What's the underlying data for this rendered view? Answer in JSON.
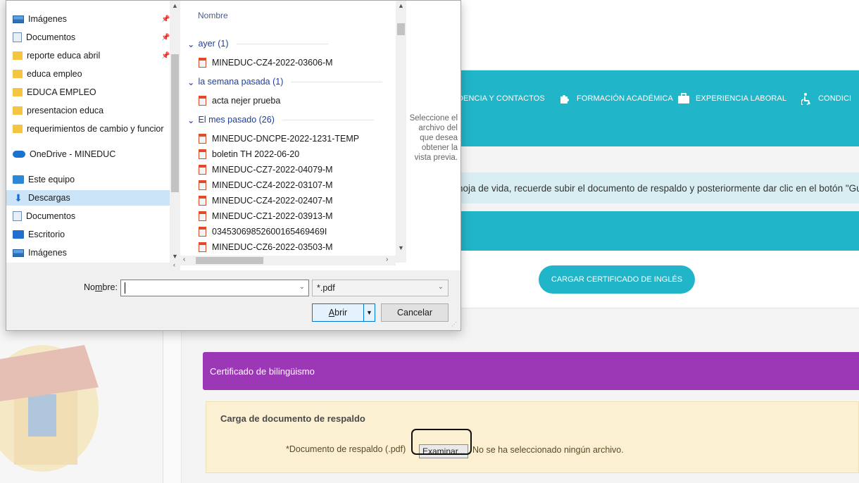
{
  "web": {
    "nav": [
      {
        "label": "DENCIA Y CONTACTOS",
        "icon": "none"
      },
      {
        "label": "FORMACIÓN ACADÉMICA",
        "icon": "puzzle-icon"
      },
      {
        "label": "EXPERIENCIA LABORAL",
        "icon": "briefcase-icon"
      },
      {
        "label": "CONDICI",
        "icon": "accessibility-icon"
      }
    ],
    "banner": "hoja de vida, recuerde subir el documento de respaldo y posteriormente dar clic en el botón \"Guardar/",
    "cert_button": "CARGAR CERTIFICADO DE INGLÉS",
    "section_title": "Certificado de bilingüismo",
    "upload": {
      "title": "Carga de documento de respaldo",
      "label": "*Documento de respaldo (.pdf)",
      "browse": "Examinar...",
      "no_file": "No se ha seleccionado ningún archivo."
    },
    "colors": {
      "teal": "#21b5c9",
      "purple": "#9c38b6",
      "panel": "#fcf0d2"
    }
  },
  "dialog": {
    "nav_items": [
      {
        "label": "Imágenes",
        "icon": "pictures-icon",
        "pinned": true
      },
      {
        "label": "Documentos",
        "icon": "documents-icon",
        "pinned": true
      },
      {
        "label": "reporte educa abril",
        "icon": "folder-icon",
        "pinned": true
      },
      {
        "label": "educa empleo",
        "icon": "folder-icon",
        "pinned": false
      },
      {
        "label": "EDUCA EMPLEO",
        "icon": "folder-icon",
        "pinned": false
      },
      {
        "label": "presentacion educa",
        "icon": "folder-icon",
        "pinned": false
      },
      {
        "label": "requerimientos de cambio y funcior",
        "icon": "folder-icon",
        "pinned": false
      },
      {
        "label": "OneDrive - MINEDUC",
        "icon": "onedrive-icon",
        "pinned": false
      },
      {
        "label": "Este equipo",
        "icon": "computer-icon",
        "pinned": false
      },
      {
        "label": "Descargas",
        "icon": "downloads-icon",
        "pinned": false,
        "selected": true
      },
      {
        "label": "Documentos",
        "icon": "documents-icon",
        "pinned": false
      },
      {
        "label": "Escritorio",
        "icon": "desktop-icon",
        "pinned": false
      },
      {
        "label": "Imágenes",
        "icon": "pictures-icon",
        "pinned": false
      }
    ],
    "column_header": "Nombre",
    "groups": [
      {
        "label": "ayer (1)",
        "files": [
          "MINEDUC-CZ4-2022-03606-M"
        ]
      },
      {
        "label": "la semana pasada (1)",
        "files": [
          "acta nejer prueba"
        ]
      },
      {
        "label": "El mes pasado (26)",
        "files": [
          "MINEDUC-DNCPE-2022-1231-TEMP",
          "boletin TH 2022-06-20",
          "MINEDUC-CZ7-2022-04079-M",
          "MINEDUC-CZ4-2022-03107-M",
          "MINEDUC-CZ4-2022-02407-M",
          "MINEDUC-CZ1-2022-03913-M",
          "03453069852600165469469I",
          "MINEDUC-CZ6-2022-03503-M"
        ]
      }
    ],
    "preview_text": "Seleccione el archivo del que desea obtener la vista previa.",
    "name_label_pre": "No",
    "name_label_ul": "m",
    "name_label_post": "bre:",
    "name_value": "",
    "filetype": "*.pdf",
    "open_pre": "",
    "open_ul": "A",
    "open_post": "brir",
    "cancel": "Cancelar"
  }
}
